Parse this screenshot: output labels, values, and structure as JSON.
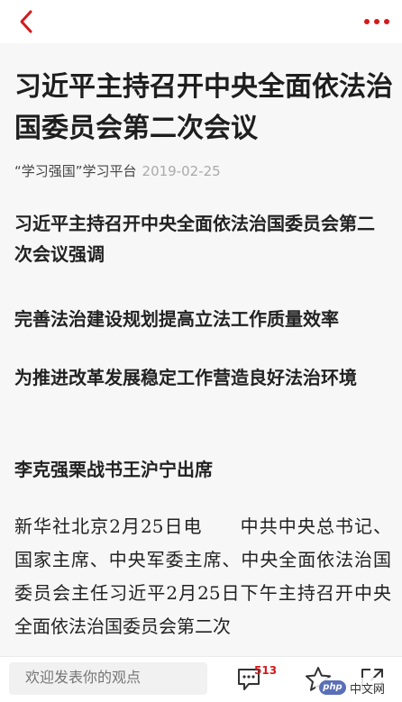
{
  "colors": {
    "accent": "#d4191c",
    "article_bg": "#f7f7f7"
  },
  "header": {
    "back_icon": "chevron-left-icon",
    "more_icon": "more-dots-icon"
  },
  "article": {
    "title": "习近平主持召开中央全面依法治国委员会第二次会议",
    "source": "“学习强国”学习平台",
    "date": "2019-02-25",
    "subheads": [
      "习近平主持召开中央全面依法治国委员会第二次会议强调",
      "完善法治建设规划提高立法工作质量效率",
      "为推进改革发展稳定工作营造良好法治环境",
      "李克强栗战书王沪宁出席"
    ],
    "body": "新华社北京2月25日电　　中共中央总书记、国家主席、中央军委主席、中央全面依法治国委员会主任习近平2月25日下午主持召开中央全面依法治国委员会第二次"
  },
  "bottom_bar": {
    "comment_placeholder": "欢迎发表你的观点",
    "comment_count": "513",
    "comments_icon": "comment-icon",
    "favorite_icon": "star-icon",
    "share_icon": "share-icon"
  },
  "watermark": {
    "logo_text": "php",
    "text": "中文网"
  }
}
